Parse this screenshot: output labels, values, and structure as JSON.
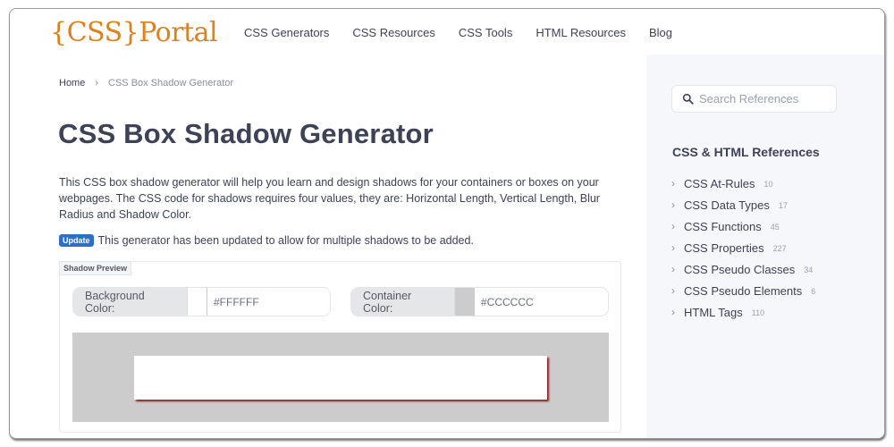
{
  "header": {
    "logo": "{CSS}Portal",
    "nav": [
      "CSS Generators",
      "CSS Resources",
      "CSS Tools",
      "HTML Resources",
      "Blog"
    ]
  },
  "breadcrumb": {
    "home": "Home",
    "separator": "›",
    "current": "CSS Box Shadow Generator"
  },
  "page": {
    "title": "CSS Box Shadow Generator",
    "intro": "This CSS box shadow generator will help you learn and design shadows for your containers or boxes on your webpages. The CSS code for shadows requires four values, they are: Horizontal Length, Vertical Length, Blur Radius and Shadow Color.",
    "update_badge": "Update",
    "update_text": "This generator has been updated to allow for multiple shadows to be added."
  },
  "preview": {
    "label": "Shadow Preview",
    "background_color": {
      "label": "Background Color:",
      "value": "#FFFFFF",
      "swatch": "#FFFFFF"
    },
    "container_color": {
      "label": "Container Color:",
      "value": "#CCCCCC",
      "swatch": "#CCCCCC"
    },
    "shadow_color": "#8B1A1A"
  },
  "sidebar": {
    "search_placeholder": "Search References",
    "title": "CSS & HTML References",
    "items": [
      {
        "label": "CSS At-Rules",
        "count": "10"
      },
      {
        "label": "CSS Data Types",
        "count": "17"
      },
      {
        "label": "CSS Functions",
        "count": "45"
      },
      {
        "label": "CSS Properties",
        "count": "227"
      },
      {
        "label": "CSS Pseudo Classes",
        "count": "34"
      },
      {
        "label": "CSS Pseudo Elements",
        "count": "6"
      },
      {
        "label": "HTML Tags",
        "count": "110"
      }
    ]
  },
  "colors": {
    "brand": "#D9821E",
    "text": "#3D4256",
    "badge": "#2E6FC2"
  }
}
